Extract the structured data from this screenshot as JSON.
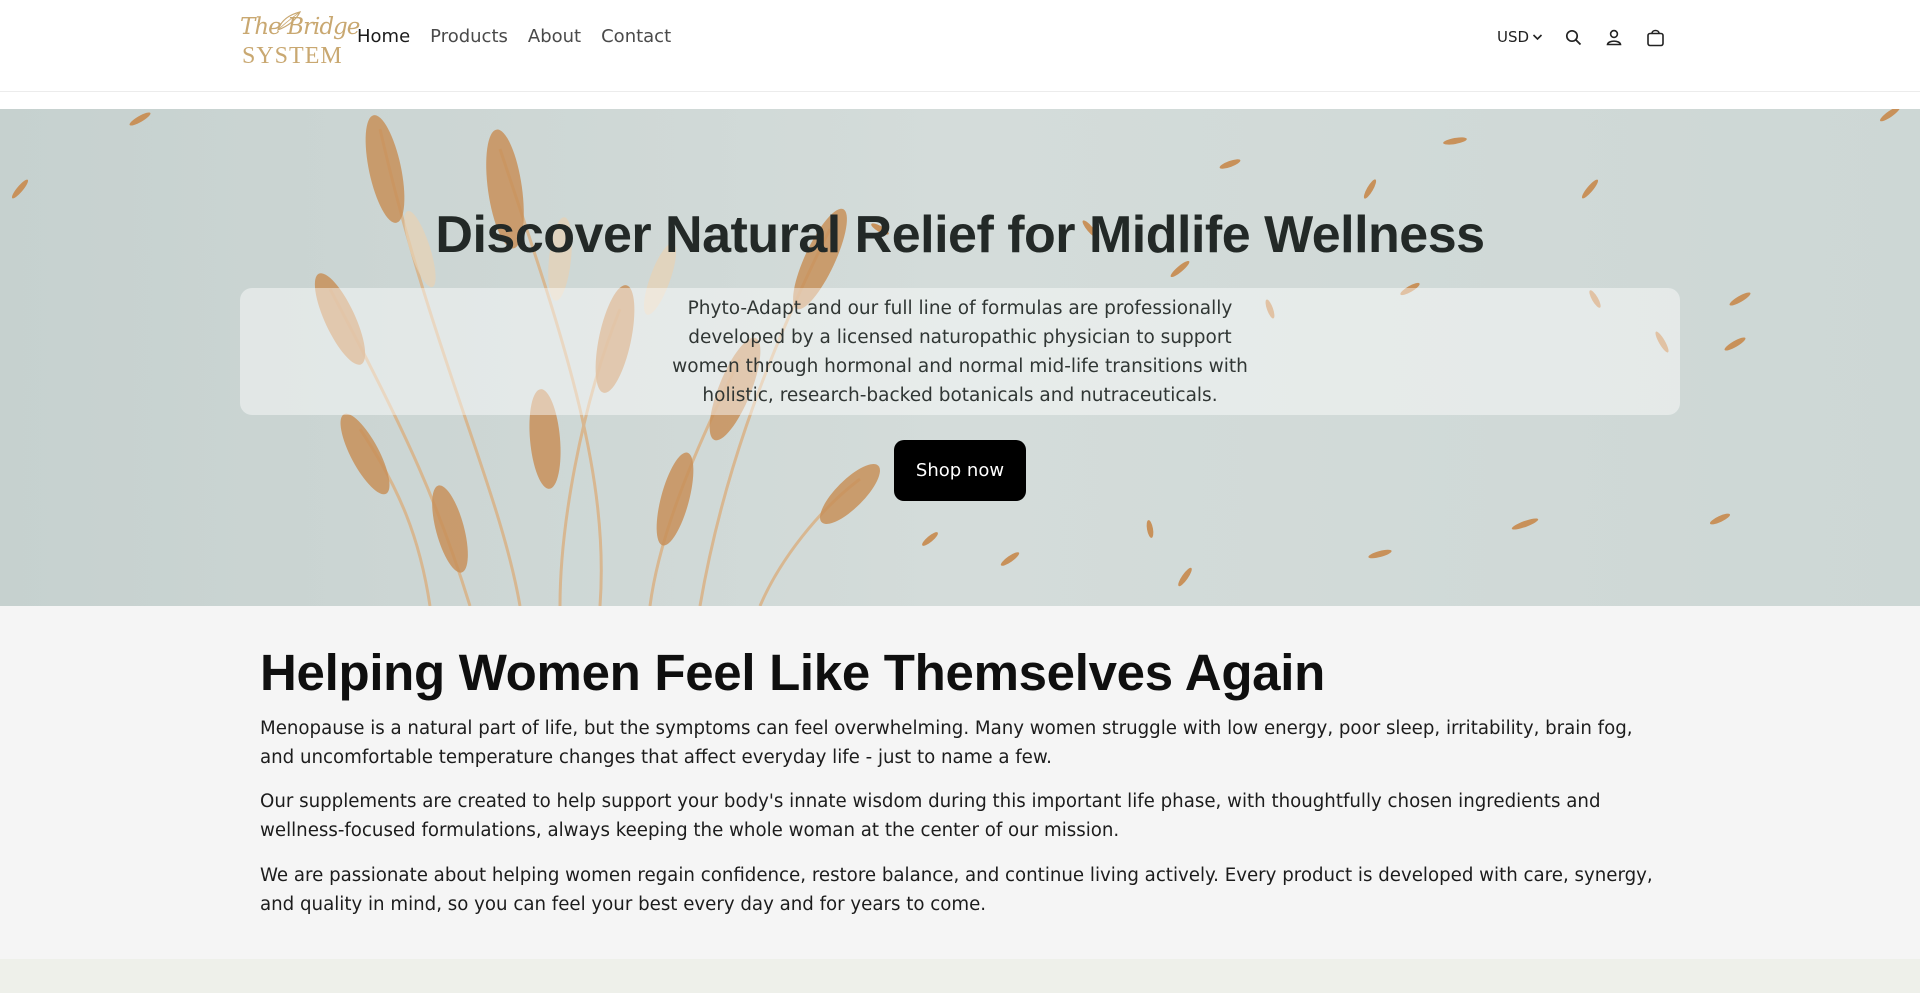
{
  "brand": {
    "logo_script": "The Bridge",
    "logo_word": "SYSTEM",
    "accent_color": "#c9a871"
  },
  "nav": {
    "items": [
      {
        "label": "Home"
      },
      {
        "label": "Products"
      },
      {
        "label": "About"
      },
      {
        "label": "Contact"
      }
    ]
  },
  "header_tools": {
    "currency": "USD",
    "icons": [
      "chevron-down-icon",
      "search-icon",
      "account-icon",
      "cart-icon"
    ]
  },
  "hero": {
    "title": "Discover Natural Relief for Midlife Wellness",
    "description": "Phyto-Adapt and our full line of formulas are professionally developed by a licensed naturopathic physician to support women through hormonal and normal mid-life transitions with holistic, research-backed botanicals and nutraceuticals.",
    "button_label": "Shop now",
    "background_color": "#cfd8d6"
  },
  "about": {
    "heading": "Helping Women Feel Like Themselves Again",
    "paragraphs": [
      "Menopause is a natural part of life, but the symptoms can feel overwhelming. Many women struggle with low energy, poor sleep, irritability, brain fog, and uncomfortable temperature changes that affect everyday life - just to name a few.",
      "Our supplements are created to help support your body's innate wisdom during this important life phase, with thoughtfully chosen ingredients and wellness-focused formulations, always keeping the whole woman at the center of our mission.",
      "We are passionate about helping women regain confidence, restore balance, and continue living actively. Every product is developed with care, synergy, and quality in mind, so you can feel your best every day and for years to come."
    ]
  }
}
